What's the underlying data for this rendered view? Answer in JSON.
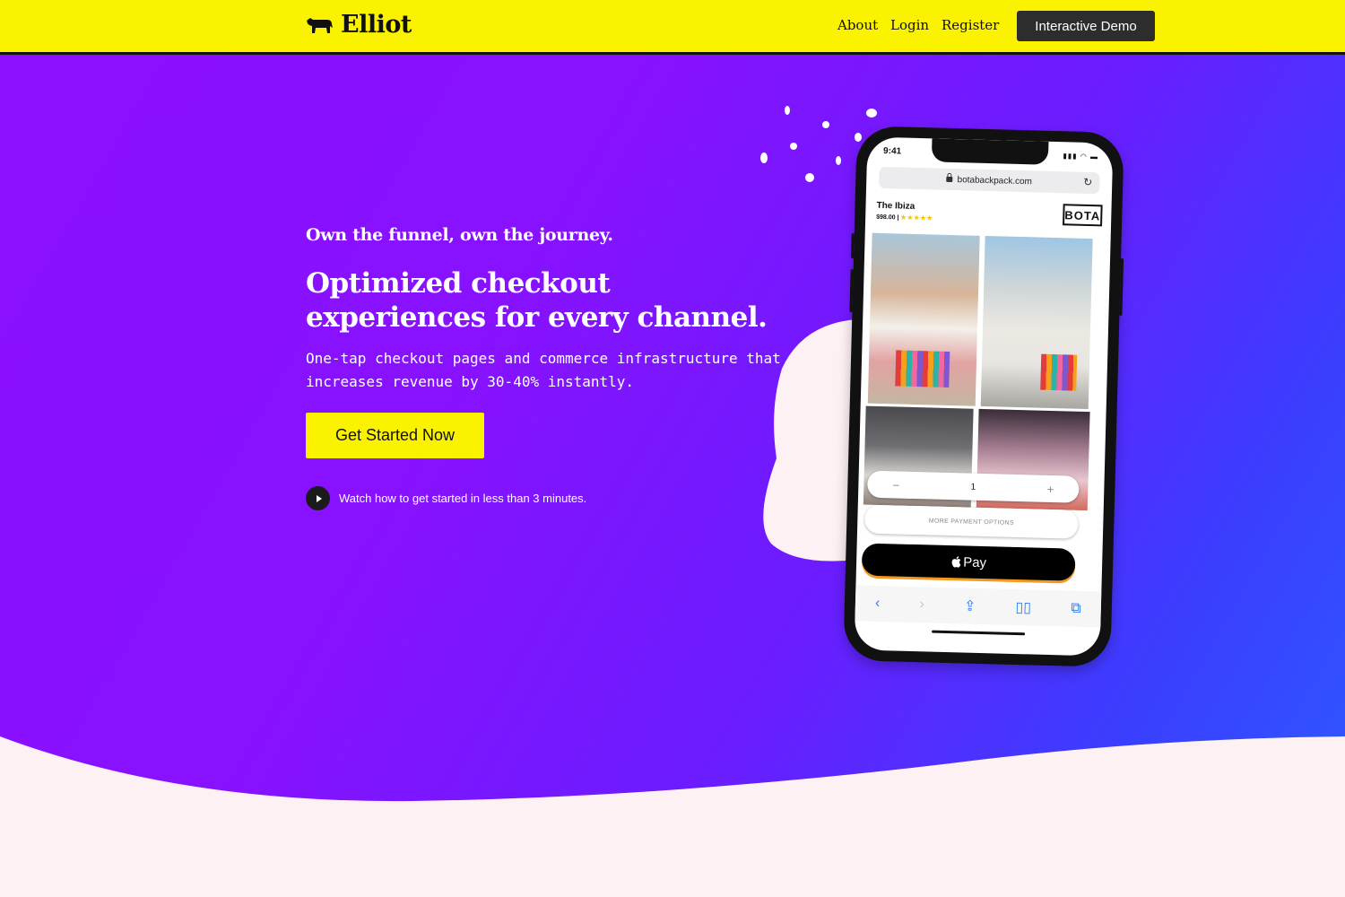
{
  "header": {
    "brand": "Elliot",
    "nav": {
      "about": "About",
      "login": "Login",
      "register": "Register"
    },
    "demo_button": "Interactive Demo"
  },
  "hero": {
    "tagline": "Own the funnel, own the journey.",
    "headline": "Optimized checkout experiences for every channel.",
    "subtext": "One-tap checkout pages and commerce infrastructure that increases revenue by 30-40% instantly.",
    "cta": "Get Started Now",
    "watch_text": "Watch how to get started in less than 3 minutes."
  },
  "phone": {
    "time": "9:41",
    "url": "botabackpack.com",
    "product_name": "The Ibiza",
    "product_price": "$98.00 |",
    "rating_stars": "★★★★★",
    "brand_logo": "BOTA",
    "quantity": "1",
    "minus": "−",
    "plus": "+",
    "more_payment": "MORE PAYMENT OPTIONS",
    "apple_pay": "Pay"
  },
  "colors": {
    "header_yellow": "#fbf200",
    "cta_yellow": "#fbf200",
    "hero_gradient_start": "#8a10ff",
    "hero_gradient_end": "#2d5bff",
    "demo_button_bg": "#2d2d2d",
    "footer_bg": "#fdf1f3"
  }
}
